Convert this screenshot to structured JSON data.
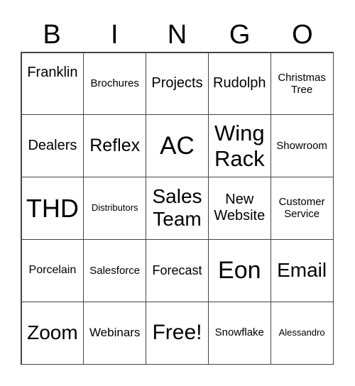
{
  "header": [
    "B",
    "I",
    "N",
    "G",
    "O"
  ],
  "cells": [
    "Franklin",
    "Brochures",
    "Projects",
    "Rudolph",
    "Christmas Tree",
    "Dealers",
    "Reflex",
    "AC",
    "Wing Rack",
    "Showroom",
    "THD",
    "Distributors",
    "Sales Team",
    "New Website",
    "Customer Service",
    "Porcelain",
    "Salesforce",
    "Forecast",
    "Eon",
    "Email",
    "Zoom",
    "Webinars",
    "Free!",
    "Snowflake",
    "Alessandro"
  ]
}
